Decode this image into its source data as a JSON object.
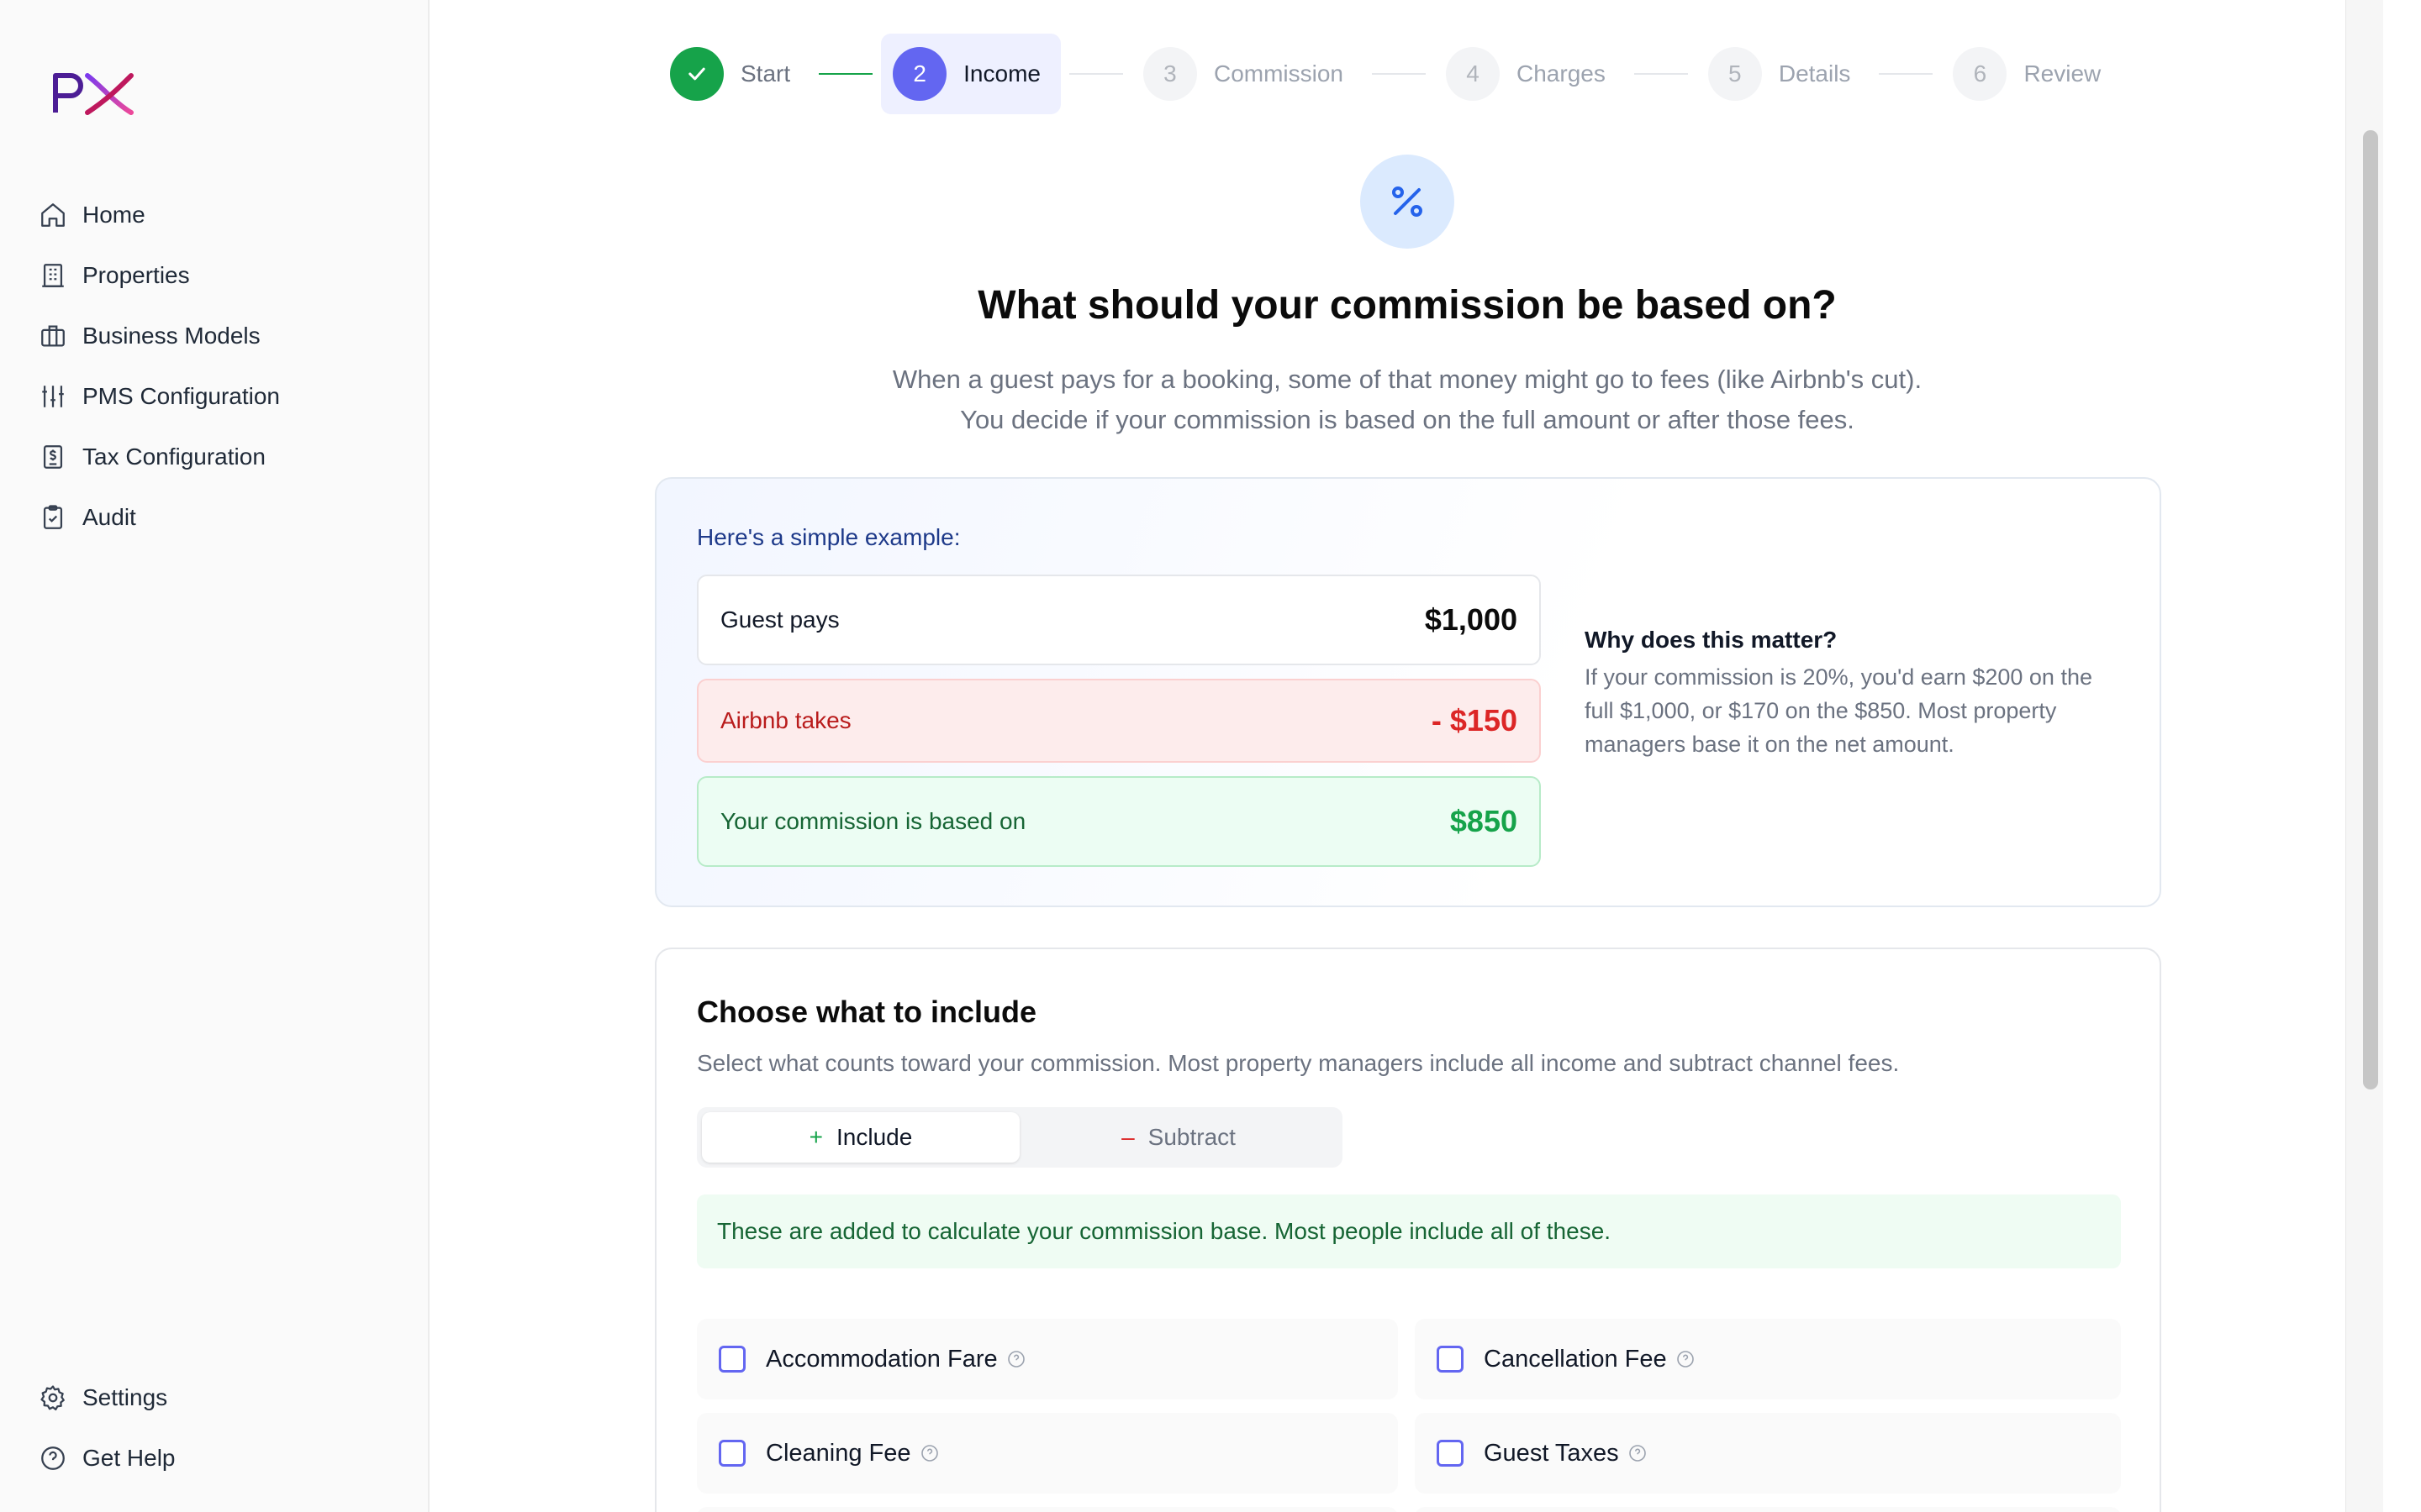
{
  "brand": {
    "logo_text": "PX",
    "accent": "#6366f1",
    "success": "#16a34a",
    "danger": "#dc2626"
  },
  "sidebar": {
    "items": [
      {
        "label": "Home",
        "icon": "home-icon"
      },
      {
        "label": "Properties",
        "icon": "building-icon"
      },
      {
        "label": "Business Models",
        "icon": "briefcase-icon"
      },
      {
        "label": "PMS Configuration",
        "icon": "sliders-icon"
      },
      {
        "label": "Tax Configuration",
        "icon": "receipt-icon"
      },
      {
        "label": "Audit",
        "icon": "clipboard-check-icon"
      }
    ],
    "bottom_items": [
      {
        "label": "Settings",
        "icon": "gear-icon"
      },
      {
        "label": "Get Help",
        "icon": "help-circle-icon"
      }
    ]
  },
  "stepper": {
    "steps": [
      {
        "number": "1",
        "label": "Start",
        "state": "done"
      },
      {
        "number": "2",
        "label": "Income",
        "state": "active"
      },
      {
        "number": "3",
        "label": "Commission",
        "state": "upcoming"
      },
      {
        "number": "4",
        "label": "Charges",
        "state": "upcoming"
      },
      {
        "number": "5",
        "label": "Details",
        "state": "upcoming"
      },
      {
        "number": "6",
        "label": "Review",
        "state": "upcoming"
      }
    ]
  },
  "hero": {
    "icon": "percent-icon",
    "title": "What should your commission be based on?",
    "subtitle_line1": "When a guest pays for a booking, some of that money might go to fees (like Airbnb's cut).",
    "subtitle_line2": "You decide if your commission is based on the full amount or after those fees."
  },
  "example": {
    "heading": "Here's a simple example:",
    "guest_label": "Guest pays",
    "guest_value": "$1,000",
    "airbnb_label": "Airbnb takes",
    "airbnb_value": "- $150",
    "base_label": "Your commission is based on",
    "base_value": "$850",
    "why_title": "Why does this matter?",
    "why_text": "If your commission is 20%, you'd earn $200 on the full $1,000, or $170 on the $850. Most property managers base it on the net amount."
  },
  "include": {
    "title": "Choose what to include",
    "subtitle": "Select what counts toward your commission. Most property managers include all income and subtract channel fees.",
    "toggle_include": "Include",
    "toggle_subtract": "Subtract",
    "banner": "These are added to calculate your commission base. Most people include all of these.",
    "options": [
      "Accommodation Fare",
      "Cancellation Fee",
      "Cleaning Fee",
      "Guest Taxes"
    ]
  }
}
